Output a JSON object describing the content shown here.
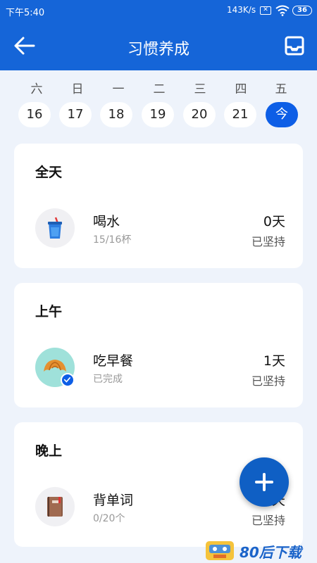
{
  "status_bar": {
    "time": "下午5:40",
    "network_speed": "143K/s",
    "sim_icon": "x-icon",
    "wifi_icon": "wifi-icon",
    "battery": "36"
  },
  "app_bar": {
    "back_icon": "arrow-left-icon",
    "title": "习惯养成",
    "inbox_icon": "inbox-icon"
  },
  "week": {
    "days": [
      "六",
      "日",
      "一",
      "二",
      "三",
      "四",
      "五"
    ],
    "dates": [
      "16",
      "17",
      "18",
      "19",
      "20",
      "21",
      "今"
    ],
    "selected": "今"
  },
  "sections": [
    {
      "title": "全天",
      "habits": [
        {
          "icon": "cup-icon",
          "name": "喝水",
          "sub": "15/16杯",
          "days": "0天",
          "streak": "已坚持",
          "done": false
        }
      ]
    },
    {
      "title": "上午",
      "habits": [
        {
          "icon": "croissant-icon",
          "name": "吃早餐",
          "sub": "已完成",
          "days": "1天",
          "streak": "已坚持",
          "done": true
        }
      ]
    },
    {
      "title": "晚上",
      "habits": [
        {
          "icon": "book-icon",
          "name": "背单词",
          "sub": "0/20个",
          "days": "天",
          "streak": "已坚持",
          "done": false
        }
      ]
    }
  ],
  "fab": {
    "icon": "plus-icon"
  },
  "watermark": {
    "icon": "cassette-icon",
    "text": "80后下载"
  },
  "colors": {
    "primary": "#1565d8",
    "accent": "#0d5ee6",
    "background": "#eef3fb"
  }
}
